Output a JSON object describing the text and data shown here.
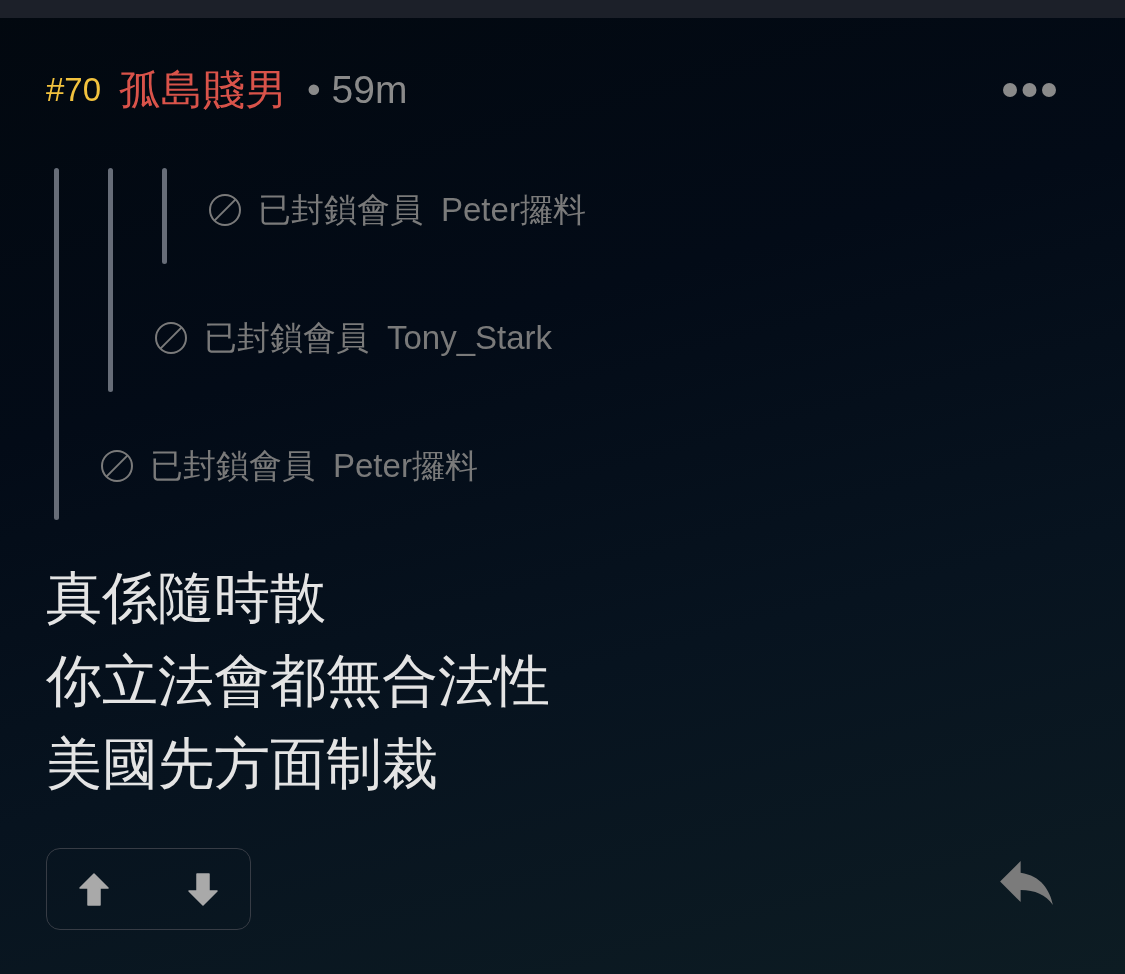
{
  "header": {
    "floor": "#70",
    "author": "孤島賤男",
    "time": "• 59m"
  },
  "quote": {
    "label": "已封鎖會員",
    "user": "Peter攞料",
    "children": [
      {
        "label": "已封鎖會員",
        "user": "Tony_Stark",
        "children": [
          {
            "label": "已封鎖會員",
            "user": "Peter攞料"
          }
        ]
      }
    ]
  },
  "body": [
    "真係隨時散",
    "你立法會都無合法性",
    "美國先方面制裁"
  ]
}
